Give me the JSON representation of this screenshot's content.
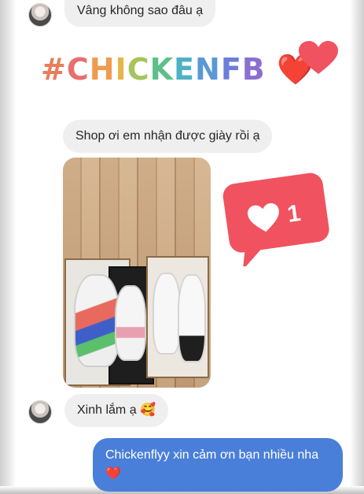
{
  "conversation": {
    "reply_top": "Vâng không sao đâu ạ",
    "hashtag": {
      "text": "#CHICKENFB",
      "emoji": "❤️",
      "colors": [
        "#e97d5a",
        "#e86f6f",
        "#ef9b4f",
        "#e6b648",
        "#a7c45c",
        "#5fbf8a",
        "#4fb1c4",
        "#5a98d6",
        "#6d7ed8",
        "#8a6fd0"
      ]
    },
    "customer_message": "Shop ơi em nhận được giày rồi ạ",
    "customer_reply": "Xinh lắm ạ 🥰",
    "shop_reply": "Chickenflyy xin cảm ơn bạn nhiều nha ❤️"
  },
  "stickers": {
    "heart_color": "#f0525f",
    "like_count": "1",
    "like_color": "#f0525f"
  }
}
